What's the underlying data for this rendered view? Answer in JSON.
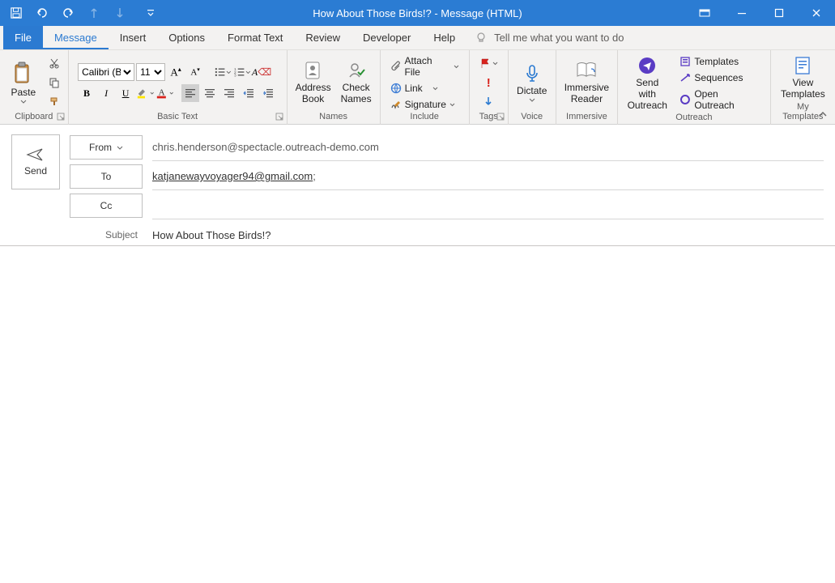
{
  "window": {
    "title": "How About Those Birds!?  -  Message (HTML)"
  },
  "qat": {
    "save": "Save",
    "undo": "Undo",
    "redo": "Redo"
  },
  "tabs": {
    "file": "File",
    "message": "Message",
    "insert": "Insert",
    "options": "Options",
    "format_text": "Format Text",
    "review": "Review",
    "developer": "Developer",
    "help": "Help",
    "tell_me": "Tell me what you want to do"
  },
  "ribbon": {
    "clipboard": {
      "paste": "Paste",
      "group": "Clipboard"
    },
    "basic_text": {
      "font_name": "Calibri (Bod",
      "font_size": "11",
      "group": "Basic Text"
    },
    "names": {
      "address_book": "Address\nBook",
      "check_names": "Check\nNames",
      "group": "Names"
    },
    "include": {
      "attach_file": "Attach File",
      "link": "Link",
      "signature": "Signature",
      "group": "Include"
    },
    "tags": {
      "group": "Tags"
    },
    "voice": {
      "dictate": "Dictate",
      "group": "Voice"
    },
    "immersive": {
      "reader": "Immersive\nReader",
      "group": "Immersive"
    },
    "outreach": {
      "send_with": "Send with\nOutreach",
      "templates": "Templates",
      "sequences": "Sequences",
      "open": "Open Outreach",
      "group": "Outreach"
    },
    "my_templates": {
      "view": "View\nTemplates",
      "group": "My Templates"
    }
  },
  "compose": {
    "send": "Send",
    "from_label": "From",
    "from_value": "chris.henderson@spectacle.outreach-demo.com",
    "to_label": "To",
    "to_value": "katjanewayvoyager94@gmail.com",
    "cc_label": "Cc",
    "cc_value": "",
    "subject_label": "Subject",
    "subject_value": "How About Those Birds!?"
  }
}
